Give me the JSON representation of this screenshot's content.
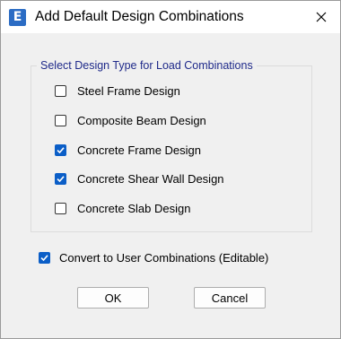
{
  "window": {
    "title": "Add Default Design Combinations",
    "app_icon_letter": "E"
  },
  "group": {
    "label": "Select Design Type for Load Combinations",
    "options": [
      {
        "label": "Steel Frame Design",
        "checked": false
      },
      {
        "label": "Composite Beam Design",
        "checked": false
      },
      {
        "label": "Concrete Frame Design",
        "checked": true
      },
      {
        "label": "Concrete Shear Wall Design",
        "checked": true
      },
      {
        "label": "Concrete Slab Design",
        "checked": false
      }
    ]
  },
  "convert": {
    "label": "Convert to User Combinations (Editable)",
    "checked": true
  },
  "buttons": {
    "ok_label": "OK",
    "cancel_label": "Cancel"
  },
  "colors": {
    "accent": "#0b5ec7",
    "group_label": "#1f2a8a",
    "dialog_background": "#f0f0f0"
  }
}
